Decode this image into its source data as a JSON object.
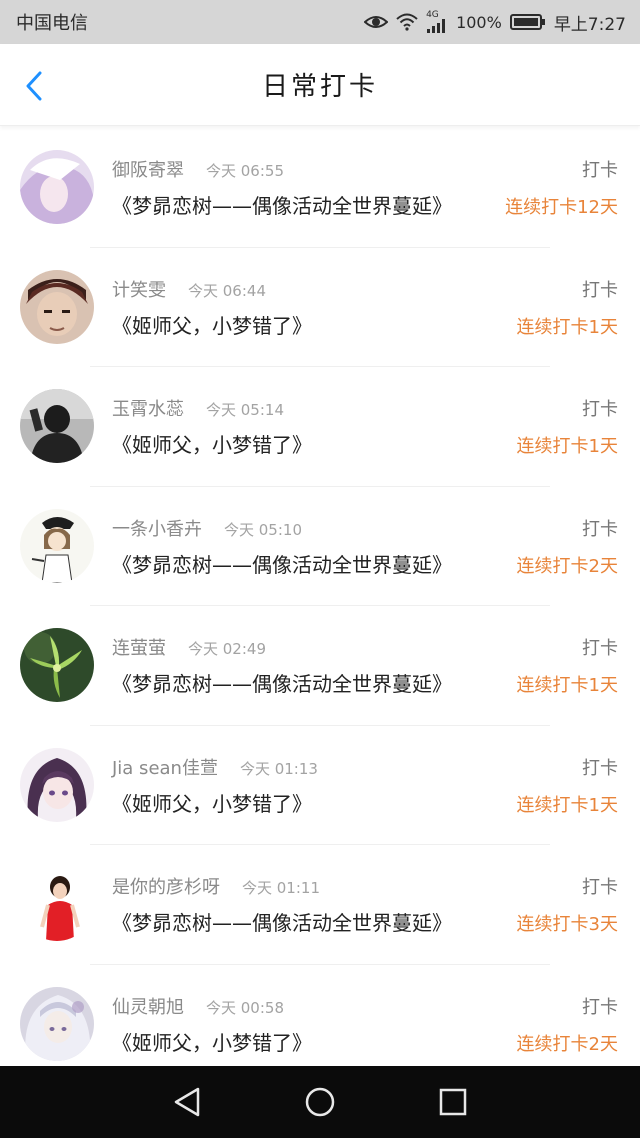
{
  "status_bar": {
    "carrier": "中国电信",
    "network": "4G",
    "battery": "100%",
    "time": "早上7:27",
    "icons": [
      "eye-icon",
      "wifi-icon",
      "signal-icon",
      "battery-icon"
    ]
  },
  "header": {
    "back_icon": "chevron-left-icon",
    "title": "日常打卡"
  },
  "colors": {
    "accent": "#1e90ff",
    "streak": "#e8843a",
    "status_bar_bg": "#d6d6d6",
    "nav_keys_bg": "#0b0b0b"
  },
  "checkins": [
    {
      "name": "御阪寄翠",
      "time": "今天 06:55",
      "type": "打卡",
      "content": "《梦昴恋树——偶像活动全世界蔓延》",
      "streak": "连续打卡12天"
    },
    {
      "name": "计笑雯",
      "time": "今天 06:44",
      "type": "打卡",
      "content": "《姬师父，小梦错了》",
      "streak": "连续打卡1天"
    },
    {
      "name": "玉霄水蕊",
      "time": "今天 05:14",
      "type": "打卡",
      "content": "《姬师父，小梦错了》",
      "streak": "连续打卡1天"
    },
    {
      "name": "一条小香卉",
      "time": "今天 05:10",
      "type": "打卡",
      "content": "《梦昴恋树——偶像活动全世界蔓延》",
      "streak": "连续打卡2天"
    },
    {
      "name": "连萤萤",
      "time": "今天 02:49",
      "type": "打卡",
      "content": "《梦昴恋树——偶像活动全世界蔓延》",
      "streak": "连续打卡1天"
    },
    {
      "name": "Jia sean佳萱",
      "time": "今天 01:13",
      "type": "打卡",
      "content": "《姬师父，小梦错了》",
      "streak": "连续打卡1天"
    },
    {
      "name": "是你的彦杉呀",
      "time": "今天 01:11",
      "type": "打卡",
      "content": "《梦昴恋树——偶像活动全世界蔓延》",
      "streak": "连续打卡3天"
    },
    {
      "name": "仙灵朝旭",
      "time": "今天 00:58",
      "type": "打卡",
      "content": "《姬师父，小梦错了》",
      "streak": "连续打卡2天"
    }
  ],
  "nav_keys": [
    "back-triangle-icon",
    "home-circle-icon",
    "recents-square-icon"
  ]
}
